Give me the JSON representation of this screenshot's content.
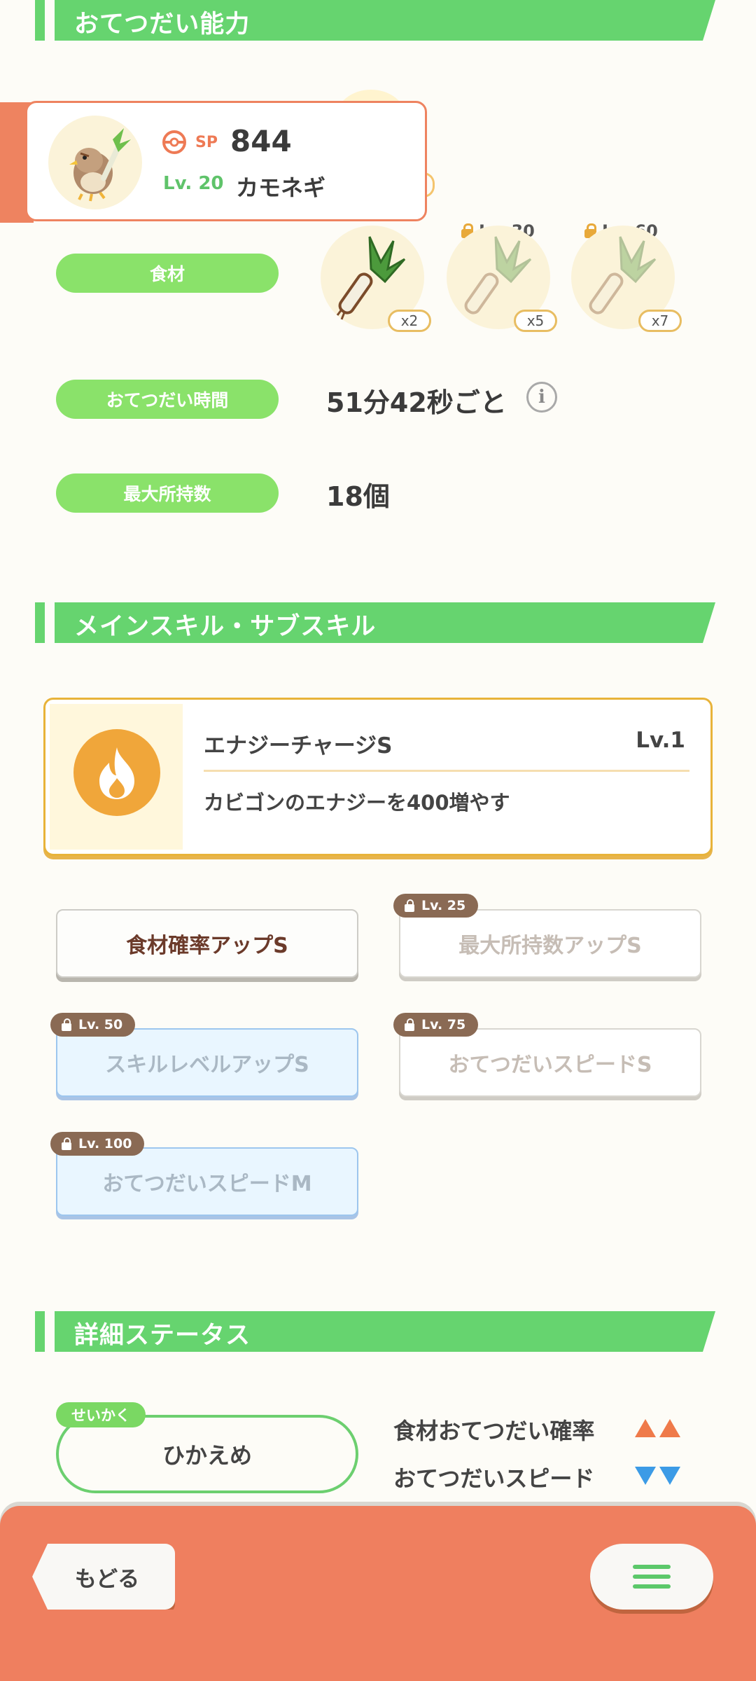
{
  "sections": {
    "helping": "おてつだい能力",
    "skills": "メインスキル・サブスキル",
    "details": "詳細ステータス"
  },
  "pokemon": {
    "sp_label": "SP",
    "sp_value": "844",
    "level": "Lv. 20",
    "name": "カモネギ"
  },
  "labels": {
    "ingredients": "食材",
    "help_time": "おてつだい時間",
    "max_carry": "最大所持数"
  },
  "ingredients": [
    {
      "count": "x2",
      "unlock": ""
    },
    {
      "count": "x5",
      "unlock": "Lv. 30"
    },
    {
      "count": "x7",
      "unlock": "Lv. 60"
    }
  ],
  "help_time_value": "51分42秒ごと",
  "max_carry_value": "18個",
  "main_skill": {
    "name": "エナジーチャージS",
    "level": "Lv.1",
    "description": "カビゴンのエナジーを400増やす"
  },
  "sub_skills": [
    {
      "name": "食材確率アップS",
      "unlock": ""
    },
    {
      "name": "最大所持数アップS",
      "unlock": "Lv. 25"
    },
    {
      "name": "スキルレベルアップS",
      "unlock": "Lv. 50"
    },
    {
      "name": "おてつだいスピードS",
      "unlock": "Lv. 75"
    },
    {
      "name": "おてつだいスピードM",
      "unlock": "Lv. 100"
    }
  ],
  "nature": {
    "tag": "せいかく",
    "name": "ひかえめ",
    "up_stat": "食材おてつだい確率",
    "down_stat": "おてつだいスピード"
  },
  "bottom": {
    "back_label": "もどる"
  },
  "colors": {
    "green": "#66d46f",
    "accent": "#ef7f5f"
  }
}
